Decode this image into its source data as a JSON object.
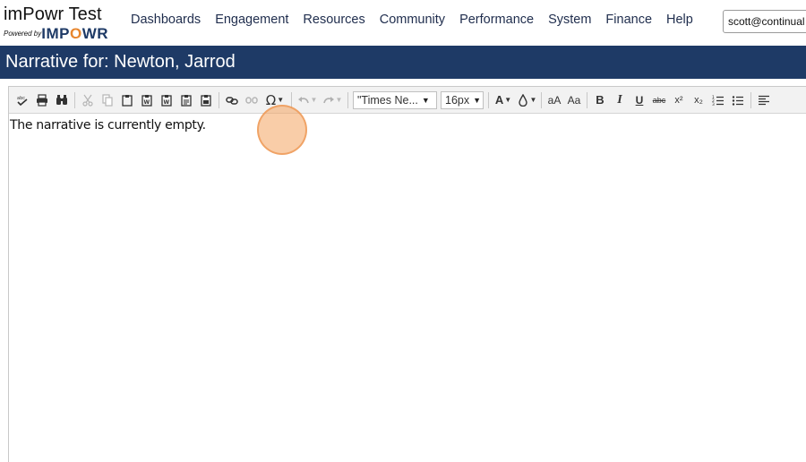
{
  "brand": {
    "title": "imPowr Test",
    "powered_by": "Powered by",
    "logo_left": "IMP",
    "logo_o": "O",
    "logo_right": "WR"
  },
  "nav": {
    "items": [
      "Dashboards",
      "Engagement",
      "Resources",
      "Community",
      "Performance",
      "System",
      "Finance",
      "Help"
    ],
    "user": "scott@continual"
  },
  "page": {
    "title": "Narrative for: Newton, Jarrod"
  },
  "toolbar": {
    "font_family": "\"Times Ne...",
    "font_size": "16px",
    "font_color_label": "A",
    "small_caps_label": "aA",
    "case_label": "Aa",
    "bold_label": "B",
    "italic_label": "I",
    "underline_label": "U",
    "strike_label": "abc",
    "superscript_label": "x²",
    "subscript_label": "x₂",
    "special_char_label": "Ω"
  },
  "editor": {
    "content": "The narrative is currently empty."
  },
  "colors": {
    "brand_navy": "#1e3a66",
    "brand_orange": "#e8862e",
    "click_marker": "#f4a460"
  }
}
